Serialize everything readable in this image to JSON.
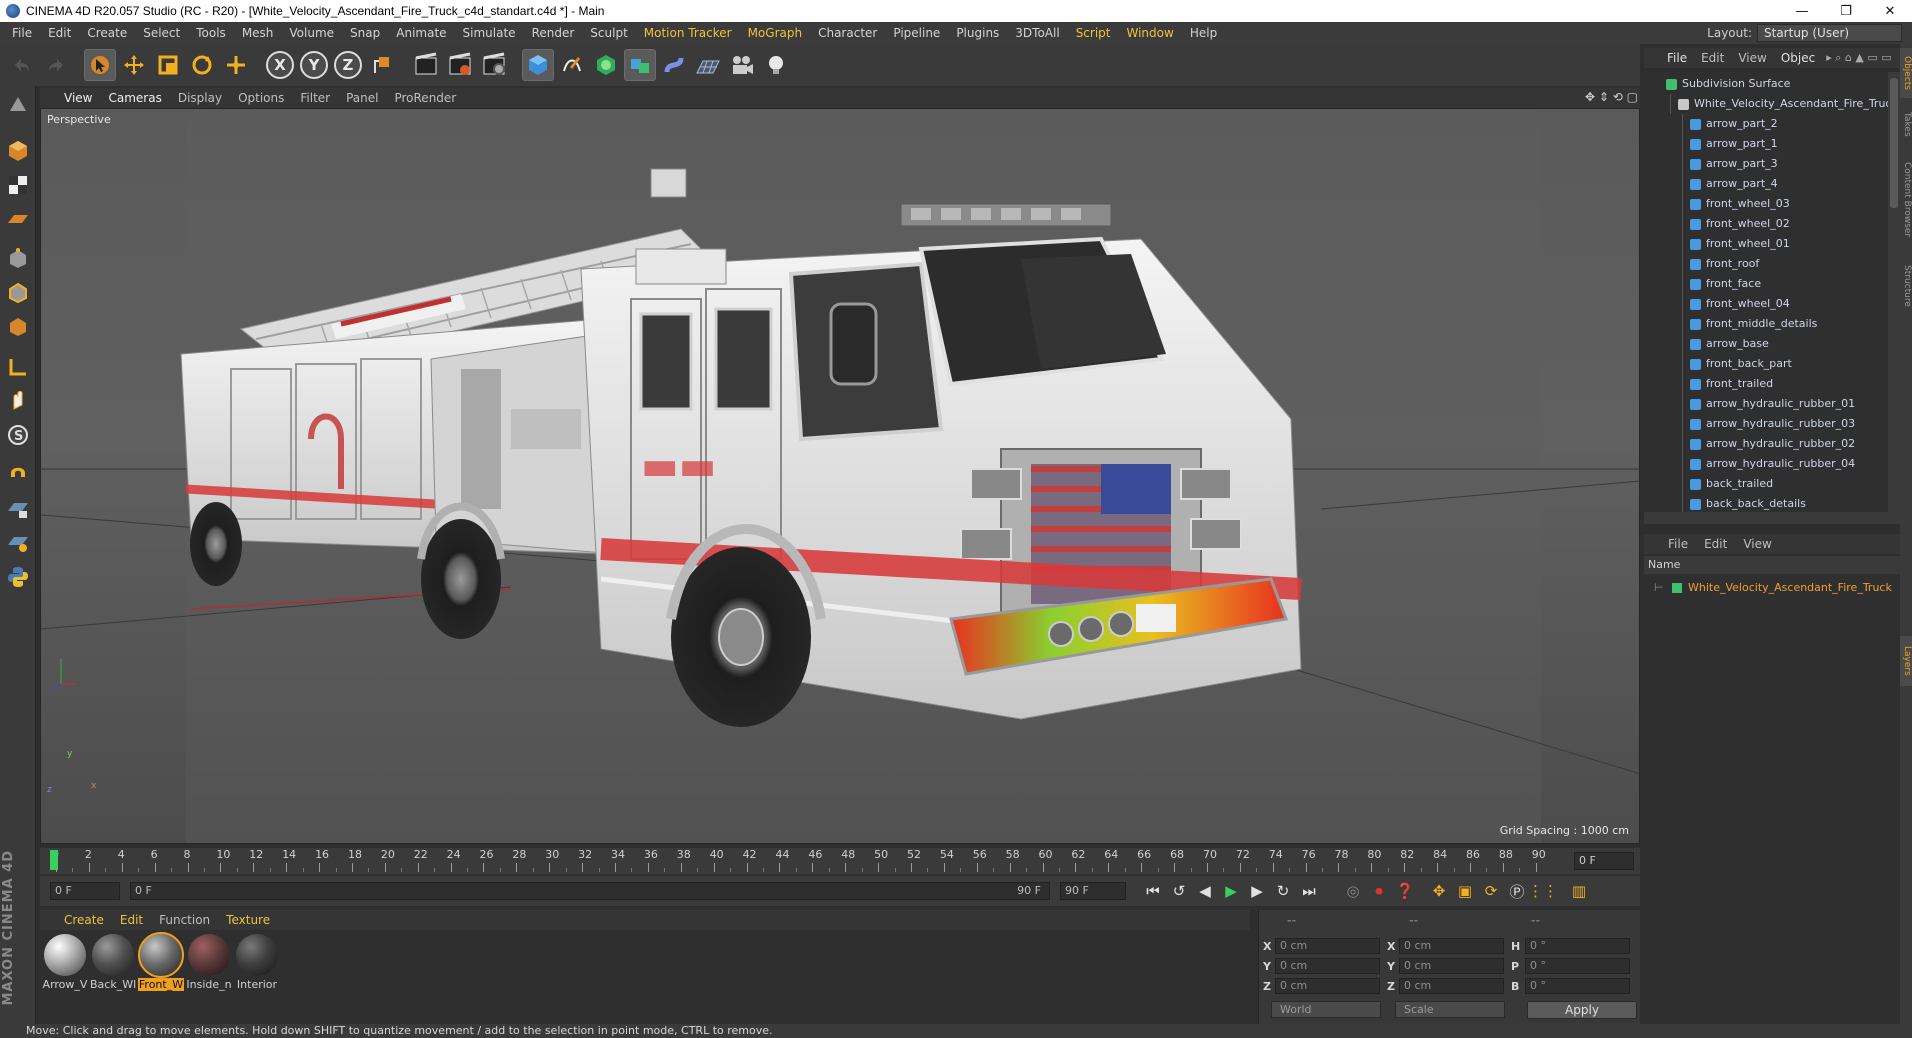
{
  "window": {
    "title": "CINEMA 4D R20.057 Studio (RC - R20) - [White_Velocity_Ascendant_Fire_Truck_c4d_standart.c4d *] - Main",
    "controls": [
      "—",
      "❐",
      "✕"
    ]
  },
  "menubar": {
    "items": [
      "File",
      "Edit",
      "Create",
      "Select",
      "Tools",
      "Mesh",
      "Volume",
      "Snap",
      "Animate",
      "Simulate",
      "Render",
      "Sculpt",
      "Motion Tracker",
      "MoGraph",
      "Character",
      "Pipeline",
      "Plugins",
      "3DToAll",
      "Script",
      "Window",
      "Help"
    ],
    "layout_label": "Layout:",
    "layout_value": "Startup (User)"
  },
  "toolbar": {
    "axis_x": "X",
    "axis_y": "Y",
    "axis_z": "Z"
  },
  "viewport": {
    "menu": [
      "View",
      "Cameras",
      "Display",
      "Options",
      "Filter",
      "Panel",
      "ProRender"
    ],
    "label": "Perspective",
    "grid_spacing": "Grid Spacing : 1000 cm",
    "nav_icons": "✥ ⇕ ⟲ ▢",
    "axis_y": "y",
    "axis_x": "x",
    "axis_z": "z",
    "colors": {
      "background": "#555555",
      "horizon": "#4e4e4e",
      "red_axis": "#b03030",
      "blue_axis": "#3040b0"
    }
  },
  "timeline": {
    "ticks": [
      "0",
      "2",
      "4",
      "6",
      "8",
      "10",
      "12",
      "14",
      "16",
      "18",
      "20",
      "22",
      "24",
      "26",
      "28",
      "30",
      "32",
      "34",
      "36",
      "38",
      "40",
      "42",
      "44",
      "46",
      "48",
      "50",
      "52",
      "54",
      "56",
      "58",
      "60",
      "62",
      "64",
      "66",
      "68",
      "70",
      "72",
      "74",
      "76",
      "78",
      "80",
      "82",
      "84",
      "86",
      "88",
      "90"
    ],
    "current_frame": "0 F",
    "start_field": "0 F",
    "range_start": "0 F",
    "range_end": "90 F",
    "end_field": "90 F"
  },
  "materials": {
    "menu": [
      "Create",
      "Edit",
      "Function",
      "Texture"
    ],
    "items": [
      {
        "name": "Arrow_V",
        "color": "#a8a8a8",
        "selected": false
      },
      {
        "name": "Back_Wl",
        "color": "#505050",
        "selected": false
      },
      {
        "name": "Front_W",
        "color": "#6a6a6a",
        "selected": true
      },
      {
        "name": "Inside_n",
        "color": "#5a3a3a",
        "selected": false
      },
      {
        "name": "Interior",
        "color": "#3e3e3e",
        "selected": false
      }
    ]
  },
  "coordinates": {
    "header1": "--",
    "header2": "--",
    "header3": "--",
    "rows": [
      {
        "l1": "X",
        "v1": "0 cm",
        "l2": "X",
        "v2": "0 cm",
        "l3": "H",
        "v3": "0 °"
      },
      {
        "l1": "Y",
        "v1": "0 cm",
        "l2": "Y",
        "v2": "0 cm",
        "l3": "P",
        "v3": "0 °"
      },
      {
        "l1": "Z",
        "v1": "0 cm",
        "l2": "Z",
        "v2": "0 cm",
        "l3": "B",
        "v3": "0 °"
      }
    ],
    "space": "World",
    "mode": "Scale",
    "apply": "Apply"
  },
  "object_manager": {
    "menu": [
      "File",
      "Edit",
      "View",
      "Objec"
    ],
    "root": "Subdivision Surface",
    "group": "White_Velocity_Ascendant_Fire_Truck",
    "children": [
      "arrow_part_2",
      "arrow_part_1",
      "arrow_part_3",
      "arrow_part_4",
      "front_wheel_03",
      "front_wheel_02",
      "front_wheel_01",
      "front_roof",
      "front_face",
      "front_wheel_04",
      "front_middle_details",
      "arrow_base",
      "front_back_part",
      "front_trailed",
      "arrow_hydraulic_rubber_01",
      "arrow_hydraulic_rubber_03",
      "arrow_hydraulic_rubber_02",
      "arrow_hydraulic_rubber_04",
      "back_trailed",
      "back_back_details"
    ]
  },
  "layer_manager": {
    "menu": [
      "File",
      "Edit",
      "View"
    ],
    "column_name": "Name",
    "layer": "White_Velocity_Ascendant_Fire_Truck",
    "layer_color": "#3fbf6f"
  },
  "right_tabs": [
    "Objects",
    "Takes",
    "Content Browser",
    "Structure",
    "Layers"
  ],
  "brand": "MAXON CINEMA 4D",
  "status": "Move: Click and drag to move elements. Hold down SHIFT to quantize movement / add to the selection in point mode, CTRL to remove."
}
